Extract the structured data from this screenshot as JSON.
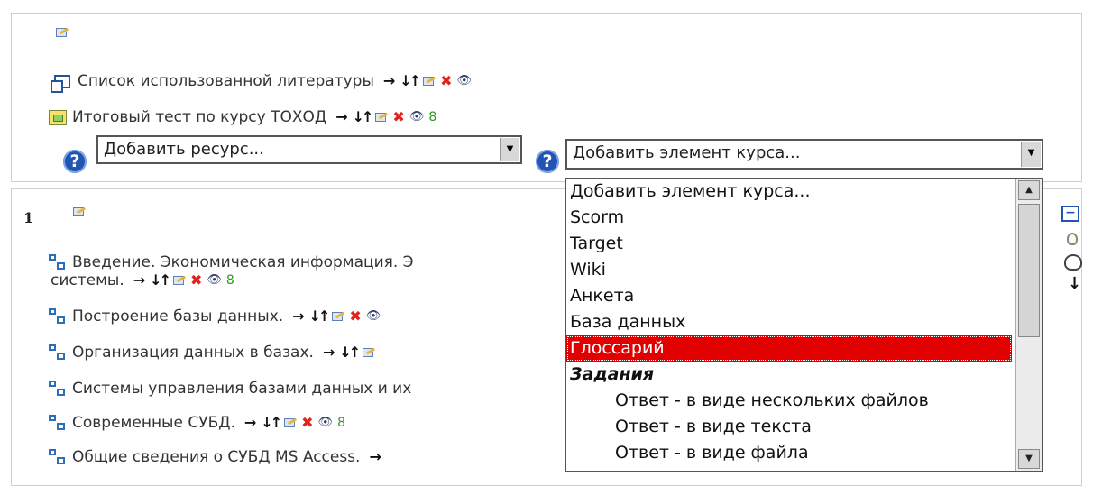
{
  "top_section": {
    "items": [
      {
        "icon": "page-stack-icon",
        "label": "Список использованной литературы"
      },
      {
        "icon": "quiz-icon",
        "label": "Итоговый тест по курсу ТОХОД"
      }
    ],
    "add_resource": {
      "value": "Добавить ресурс..."
    },
    "add_activity": {
      "value": "Добавить элемент курса..."
    }
  },
  "section_1": {
    "number": "1",
    "items": [
      {
        "label_line1": "Введение. Экономическая информация. Э",
        "label_line2": "системы."
      },
      {
        "label": "Построение базы данных."
      },
      {
        "label": "Организация данных в базах."
      },
      {
        "label": "Системы управления базами данных и их"
      },
      {
        "label": "Современные СУБД."
      },
      {
        "label": "Общие сведения о СУБД MS Access."
      }
    ]
  },
  "dropdown": {
    "options": [
      "Добавить элемент курса...",
      "Scorm",
      "Target",
      "Wiki",
      "Анкета",
      "База данных",
      "Глоссарий"
    ],
    "selected": "Глоссарий",
    "group_label": "Задания",
    "sub_options": [
      "Ответ - в виде нескольких файлов",
      "Ответ - в виде текста",
      "Ответ - в виде файла"
    ]
  },
  "icons": {
    "move_right": "→",
    "move_updown": "↓↑",
    "delete": "✖",
    "hide": "👁",
    "roles": "8",
    "help": "?",
    "collapse": "−",
    "dropdown_arrow": "▼",
    "scroll_up": "▲",
    "scroll_down": "▼"
  },
  "colors": {
    "selected_bg": "#e00000",
    "link_blue": "#24539c",
    "delete_red": "#e0241b"
  }
}
